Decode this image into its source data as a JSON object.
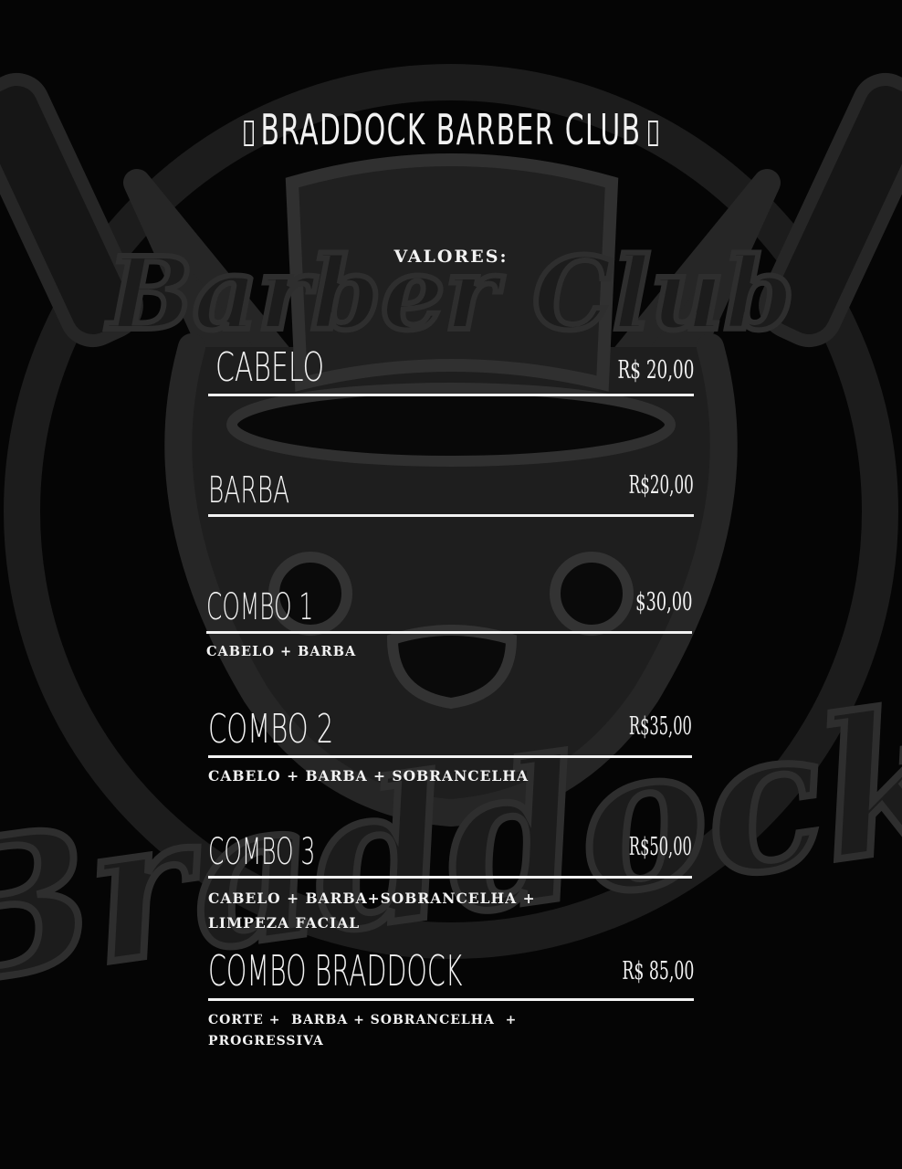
{
  "title": "BRADDOCK BARBER CLUB",
  "subheading": "VALORES:",
  "items": [
    {
      "name": "CABELO",
      "price": "R$ 20,00",
      "desc_lines": []
    },
    {
      "name": "BARBA",
      "price": "R$20,00",
      "desc_lines": []
    },
    {
      "name": "COMBO 1",
      "price": "$30,00",
      "desc_lines": [
        "CABELO + BARBA"
      ]
    },
    {
      "name": "COMBO 2",
      "price": "R$35,00",
      "desc_lines": [
        "CABELO + BARBA + SOBRANCELHA"
      ]
    },
    {
      "name": "COMBO 3",
      "price": "R$50,00",
      "desc_lines": [
        "CABELO + BARBA+SOBRANCELHA +",
        "LIMPEZA FACIAL"
      ]
    },
    {
      "name": "COMBO BRADDOCK",
      "price": "R$ 85,00",
      "desc_lines": [
        "CORTE +  BARBA + SOBRANCELHA  +",
        "PROGRESSIVA"
      ]
    }
  ],
  "background": {
    "logo_text_top": "Barber Club",
    "logo_text_bottom": "Braddock",
    "color": "#050505",
    "art_color": "#2a2a2a"
  }
}
